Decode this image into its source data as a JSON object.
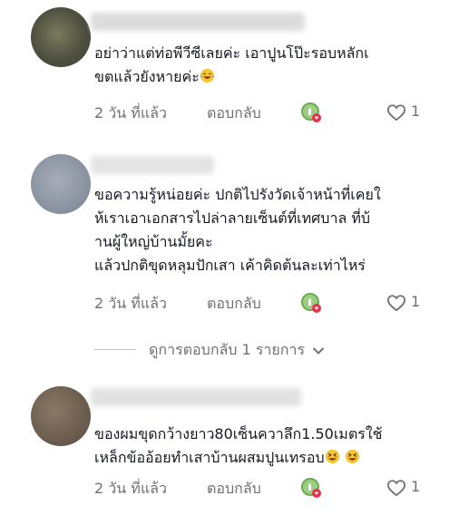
{
  "comments": [
    {
      "text_parts": [
        "อย่าว่าแต่ท่อพีวีซีเลยค่ะ เอาปูนโป๊ะรอบหลักเ\nขตแล้วยังหายค่ะ"
      ],
      "emojis": [
        "laughing-tears"
      ],
      "date": "2 วัน ที่แล้ว",
      "reply_label": "ตอบกลับ",
      "likes": "1"
    },
    {
      "text": "ขอความรู้หน่อยค่ะ ปกติไปรังวัดเจ้าหน้าที่เคยใ\nห้เราเอาเอกสารไปล่าลายเซ็นต์ที่เทศบาล ที่บ้\nานผู้ใหญ่บ้านมั้ยคะ\nแล้วปกติขุดหลุมปักเสา เค้าคิดต้นละเท่าไหร่",
      "date": "2 วัน ที่แล้ว",
      "reply_label": "ตอบกลับ",
      "likes": "1"
    },
    {
      "text_parts": [
        "ของผมขุดกว้างยาว80เซ็นควาลึก1.50เมตรใช้\nเหล็กข้ออ้อยทำเสาบ้านผสมปูนเทรอบ"
      ],
      "emojis": [
        "squinting-face",
        "squinting-face"
      ],
      "date": "2 วัน ที่แล้ว",
      "reply_label": "ตอบกลับ",
      "likes": "1"
    }
  ],
  "view_replies_label": "ดูการตอบกลับ 1 รายการ",
  "colors": {
    "text": "#161823",
    "muted": "#6f7077",
    "badge_green": "#7bb662",
    "badge_red": "#e8304c"
  },
  "icons": [
    "creator-liked-badge-icon",
    "heart-outline-icon",
    "chevron-down-icon"
  ]
}
